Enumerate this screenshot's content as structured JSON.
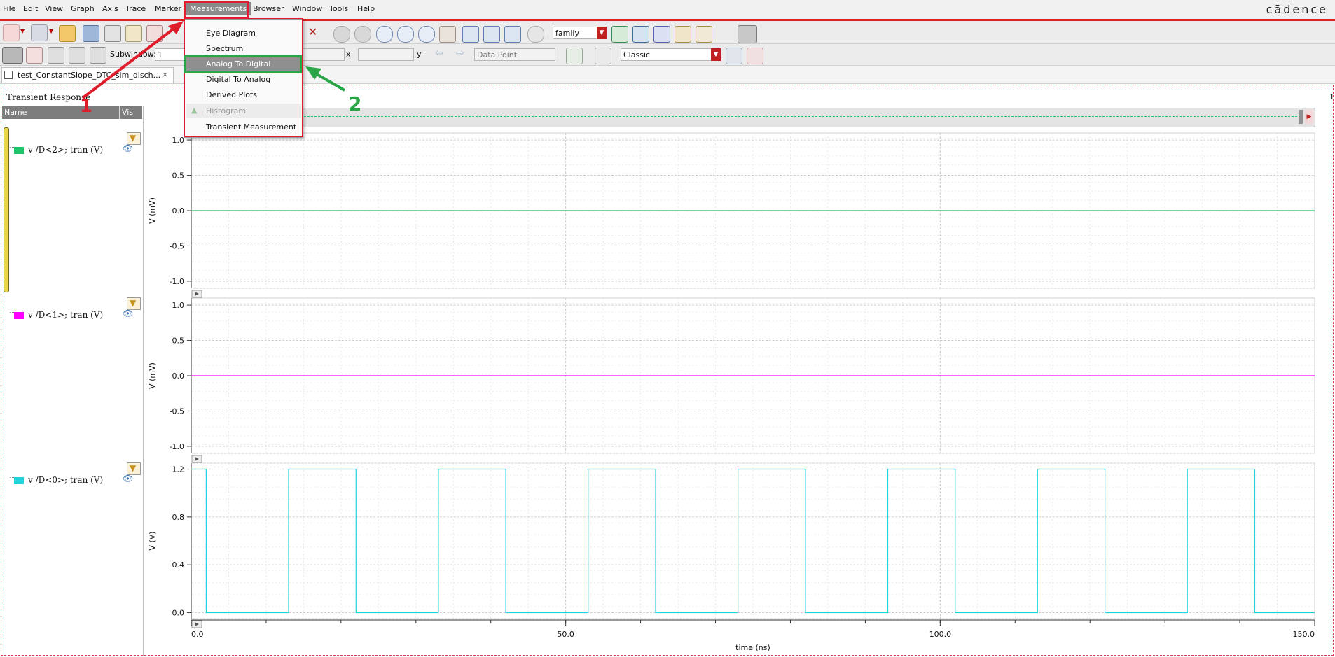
{
  "menubar": {
    "items": [
      "File",
      "Edit",
      "View",
      "Graph",
      "Axis",
      "Trace",
      "Marker",
      "Measurements",
      "Browser",
      "Window",
      "Tools",
      "Help"
    ],
    "brand": "cādence"
  },
  "toolbar": {
    "family_value": "family",
    "subwindow_label": "Subwindow:",
    "subwindow_value": "1",
    "x_label": "x",
    "y_label": "y",
    "data_point_value": "Data Point",
    "style_value": "Classic"
  },
  "tab": {
    "label": "test_ConstantSlope_DTC_sim_disch...",
    "close": "×"
  },
  "panel": {
    "title": "Transient Response",
    "name_header": "Name",
    "vis_header": "Vis",
    "page_number": "1"
  },
  "measurements_menu": {
    "items": [
      "Eye Diagram",
      "Spectrum",
      "Analog To Digital",
      "Digital To Analog",
      "Derived Plots",
      "Histogram",
      "Transient Measurement"
    ],
    "highlighted": "Analog To Digital",
    "disabled": [
      "Histogram"
    ]
  },
  "annotations": {
    "step1": "1",
    "step2": "2",
    "red": "#e01c2c",
    "green": "#2aa648"
  },
  "x_axis": {
    "label": "time (ns)",
    "ticks": [
      "0.0",
      "50.0",
      "100.0",
      "150.0"
    ]
  },
  "traces": [
    {
      "name": "v /D<2>; tran (V)",
      "color": "#1ec46a"
    },
    {
      "name": "v /D<1>; tran (V)",
      "color": "#ff00ff"
    },
    {
      "name": "v /D<0>; tran (V)",
      "color": "#22d3dd"
    }
  ],
  "chart_data": [
    {
      "type": "line",
      "series": [
        {
          "name": "v /D<2>; tran (V)",
          "x": [
            0,
            150
          ],
          "y": [
            0,
            0
          ]
        }
      ],
      "xlabel": "time (ns)",
      "ylabel": "V (mV)",
      "xlim": [
        0,
        150
      ],
      "ylim": [
        -1.1,
        1.1
      ],
      "yticks": [
        "1.0",
        "0.5",
        "0.0",
        "-0.5",
        "-1.0"
      ],
      "grid": true
    },
    {
      "type": "line",
      "series": [
        {
          "name": "v /D<1>; tran (V)",
          "x": [
            0,
            150
          ],
          "y": [
            0,
            0
          ]
        }
      ],
      "xlabel": "time (ns)",
      "ylabel": "V (mV)",
      "xlim": [
        0,
        150
      ],
      "ylim": [
        -1.1,
        1.1
      ],
      "yticks": [
        "1.0",
        "0.5",
        "0.0",
        "-0.5",
        "-1.0"
      ],
      "grid": true
    },
    {
      "type": "line",
      "series": [
        {
          "name": "v /D<0>; tran (V)",
          "x": [
            0,
            2,
            2,
            13,
            13,
            22,
            22,
            33,
            33,
            42,
            42,
            53,
            53,
            62,
            62,
            73,
            73,
            82,
            82,
            93,
            93,
            102,
            102,
            113,
            113,
            122,
            122,
            133,
            133,
            142,
            142,
            150
          ],
          "y": [
            1.2,
            1.2,
            0,
            0,
            1.2,
            1.2,
            0,
            0,
            1.2,
            1.2,
            0,
            0,
            1.2,
            1.2,
            0,
            0,
            1.2,
            1.2,
            0,
            0,
            1.2,
            1.2,
            0,
            0,
            1.2,
            1.2,
            0,
            0,
            1.2,
            1.2,
            0,
            0
          ]
        }
      ],
      "xlabel": "time (ns)",
      "ylabel": "V (V)",
      "xlim": [
        0,
        150
      ],
      "ylim": [
        -0.05,
        1.25
      ],
      "yticks": [
        "1.2",
        "0.8",
        "0.4",
        "0.0"
      ],
      "grid": true
    }
  ]
}
